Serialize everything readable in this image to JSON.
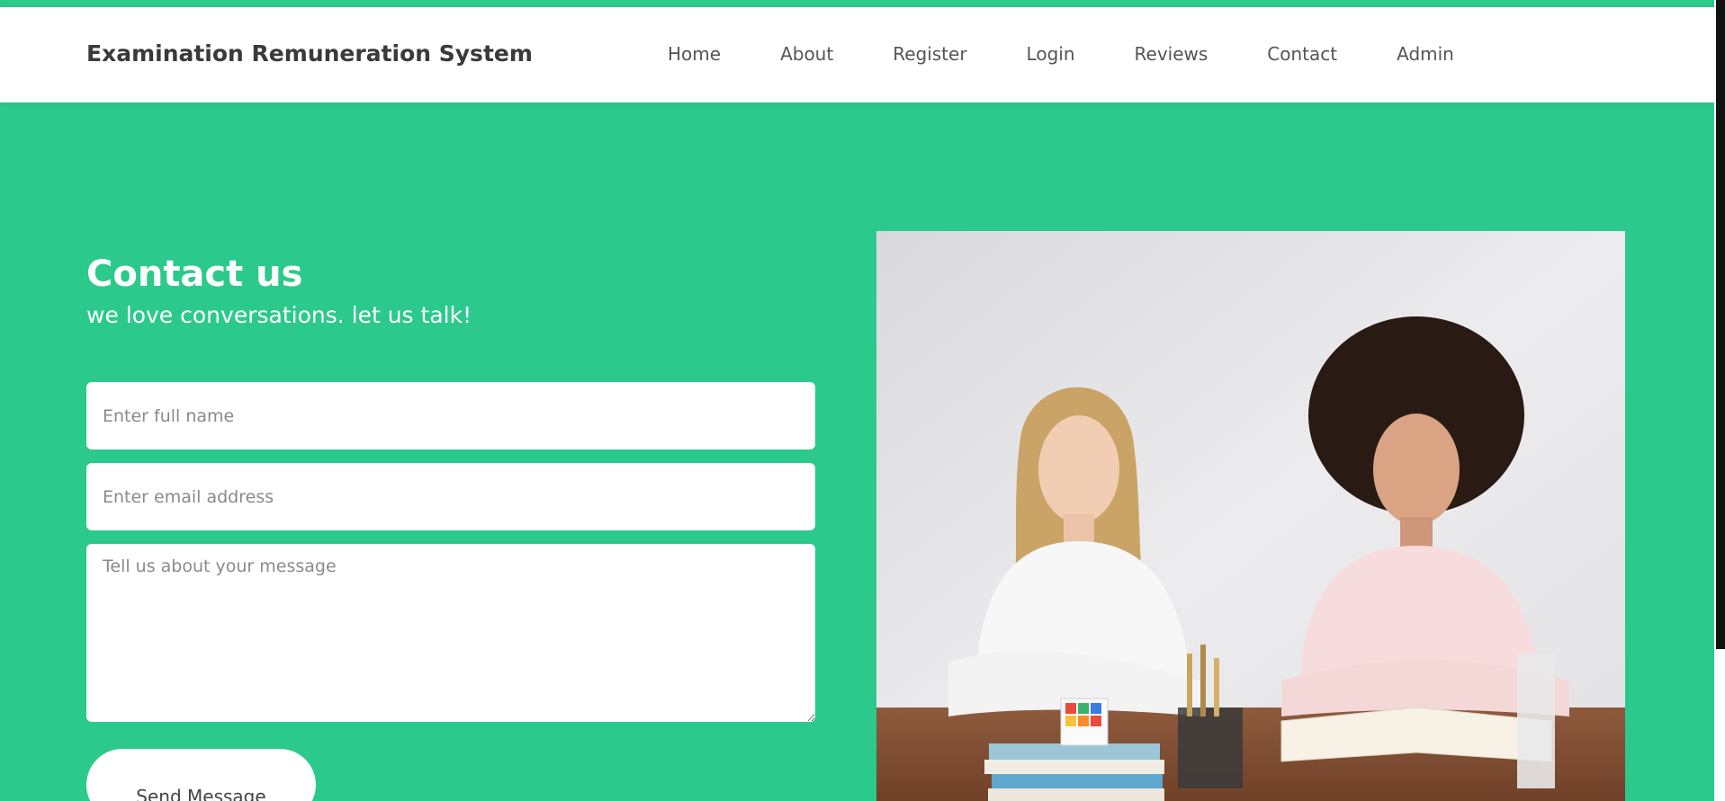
{
  "navbar": {
    "brand": "Examination Remuneration System",
    "links": [
      "Home",
      "About",
      "Register",
      "Login",
      "Reviews",
      "Contact",
      "Admin"
    ]
  },
  "contact": {
    "title": "Contact us",
    "subtitle": "we love conversations. let us talk!",
    "name_placeholder": "Enter full name",
    "email_placeholder": "Enter email address",
    "message_placeholder": "Tell us about your message",
    "send_label": "Send Message"
  },
  "colors": {
    "accent": "#2cc98d",
    "navbar_bg": "#ffffff",
    "text_dark": "#3a3a3a"
  }
}
